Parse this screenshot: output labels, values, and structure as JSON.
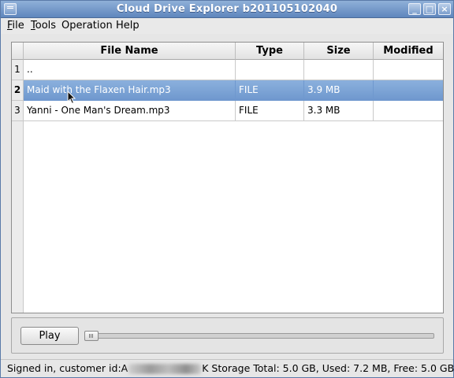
{
  "window": {
    "title": "Cloud Drive Explorer b201105102040"
  },
  "menubar": {
    "items": [
      {
        "label": "File",
        "mnemonic": "F",
        "rest": "ile"
      },
      {
        "label": "Tools",
        "mnemonic": "T",
        "rest": "ools"
      },
      {
        "label": "Operation",
        "mnemonic": "",
        "rest": "Operation"
      },
      {
        "label": "Help",
        "mnemonic": "",
        "rest": "Help"
      }
    ]
  },
  "table": {
    "columns": [
      "File Name",
      "Type",
      "Size",
      "Modified"
    ],
    "rows": [
      {
        "num": "1",
        "name": "..",
        "type": "",
        "size": "",
        "modified": ""
      },
      {
        "num": "2",
        "name": "Maid with the Flaxen Hair.mp3",
        "type": "FILE",
        "size": "3.9 MB",
        "modified": ""
      },
      {
        "num": "3",
        "name": "Yanni - One Man's Dream.mp3",
        "type": "FILE",
        "size": "3.3 MB",
        "modified": ""
      }
    ],
    "selected_row": "2"
  },
  "player": {
    "play_label": "Play",
    "progress": 0
  },
  "status": {
    "prefix": "Signed in, customer id:A",
    "suffix": "K Storage Total: 5.0 GB, Used: 7.2 MB, Free: 5.0 GB"
  },
  "colors": {
    "selection": "#7aa2d6",
    "titlebar": "#6e93c6"
  }
}
